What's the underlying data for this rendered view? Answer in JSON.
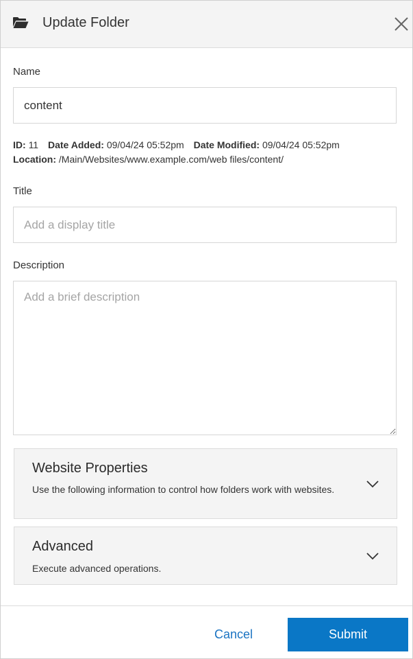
{
  "header": {
    "icon": "folder-open-icon",
    "title": "Update Folder",
    "close_icon": "close-icon"
  },
  "name": {
    "label": "Name",
    "value": "content"
  },
  "meta": {
    "id_label": "ID:",
    "id_value": "11",
    "date_added_label": "Date Added:",
    "date_added_value": "09/04/24 05:52pm",
    "date_modified_label": "Date Modified:",
    "date_modified_value": "09/04/24 05:52pm",
    "location_label": "Location:",
    "location_value": "/Main/Websites/www.example.com/web files/content/"
  },
  "title_field": {
    "label": "Title",
    "placeholder": "Add a display title",
    "value": ""
  },
  "description_field": {
    "label": "Description",
    "placeholder": "Add a brief description",
    "value": ""
  },
  "sections": [
    {
      "title": "Website Properties",
      "description": "Use the following information to control how folders work with websites.",
      "icon": "chevron-down-icon"
    },
    {
      "title": "Advanced",
      "description": "Execute advanced operations.",
      "icon": "chevron-down-icon"
    }
  ],
  "footer": {
    "cancel_label": "Cancel",
    "submit_label": "Submit"
  },
  "colors": {
    "accent": "#0a77c6",
    "link": "#1a73c2",
    "panel_bg": "#f4f4f4"
  }
}
